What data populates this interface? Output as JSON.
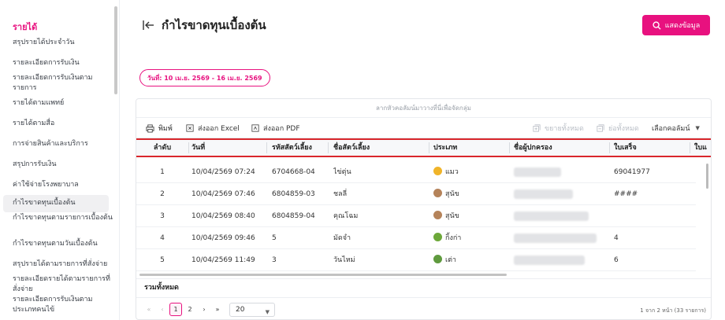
{
  "sidebar": {
    "section_title": "รายได้",
    "items": [
      {
        "label": "สรุปรายได้ประจำวัน"
      },
      {
        "label": "รายละเอียดการรับเงิน"
      },
      {
        "label": "รายละเอียดการรับเงินตามรายการ"
      },
      {
        "label": "รายได้ตามแพทย์"
      },
      {
        "label": "รายได้ตามสื่อ"
      },
      {
        "label": "การจ่ายสินค้าและบริการ"
      },
      {
        "label": "สรุปการรับเงิน"
      },
      {
        "label": "ค่าใช้จ่ายโรงพยาบาล"
      },
      {
        "label": "กำไรขาดทุนเบื้องต้น"
      },
      {
        "label": "กำไรขาดทุนตามรายการเบื้องต้น"
      },
      {
        "label": "กำไรขาดทุนตามวันเบื้องต้น"
      },
      {
        "label": "สรุปรายได้ตามรายการที่สั่งจ่าย"
      },
      {
        "label": "รายละเอียดรายได้ตามรายการที่สั่งจ่าย"
      },
      {
        "label": "รายละเอียดการรับเงินตามประเภทคนไข้"
      }
    ],
    "active_index": 8
  },
  "header": {
    "title": "กำไรขาดทุนเบื้องต้น",
    "show_button": "แสดงข้อมูล"
  },
  "filter": {
    "date_range": "วันที่: 10 เม.ย. 2569 - 16 เม.ย. 2569"
  },
  "grid": {
    "group_hint": "ลากหัวคอลัมน์มาวางที่นี่เพื่อจัดกลุ่ม",
    "toolbar": {
      "print": "พิมพ์",
      "export_excel": "ส่งออก Excel",
      "export_pdf": "ส่งออก PDF",
      "expand_all": "ขยายทั้งหมด",
      "collapse_all": "ย่อทั้งหมด",
      "choose_columns": "เลือกคอลัมน์"
    },
    "columns": [
      "ลำดับ",
      "วันที่",
      "รหัสสัตว์เลี้ยง",
      "ชื่อสัตว์เลี้ยง",
      "ประเภท",
      "ชื่อผู้ปกครอง",
      "ใบเสร็จ",
      "ใบแ"
    ],
    "rows": [
      {
        "no": "1",
        "date": "10/04/2569 07:24",
        "pet_code": "6704668-04",
        "pet_name": "ไข่ตุ่น",
        "type": "แมว",
        "type_icon": "cat-icon",
        "receipt": "69041977"
      },
      {
        "no": "2",
        "date": "10/04/2569 07:46",
        "pet_code": "6804859-03",
        "pet_name": "ชลลี่",
        "type": "สุนัข",
        "type_icon": "dog-icon",
        "receipt": "####"
      },
      {
        "no": "3",
        "date": "10/04/2569 08:40",
        "pet_code": "6804859-04",
        "pet_name": "คุณโฉม",
        "type": "สุนัข",
        "type_icon": "dog-icon",
        "receipt": ""
      },
      {
        "no": "4",
        "date": "10/04/2569 09:46",
        "pet_code": "5",
        "pet_name": "มัดจำ",
        "type": "กิ้งก่า",
        "type_icon": "lizard-icon",
        "receipt": "4"
      },
      {
        "no": "5",
        "date": "10/04/2569 11:49",
        "pet_code": "3",
        "pet_name": "วันไหม่",
        "type": "เต่า",
        "type_icon": "turtle-icon",
        "receipt": "6"
      }
    ],
    "total_label": "รวมทั้งหมด",
    "pager": {
      "first": "«",
      "prev": "‹",
      "pages": [
        "1",
        "2"
      ],
      "next": "›",
      "last": "»",
      "page_size": "20",
      "info": "1 จาก 2 หน้า (33 รายการ)"
    }
  },
  "colors": {
    "accent": "#e8117f",
    "highlight_box": "#d9262c"
  }
}
